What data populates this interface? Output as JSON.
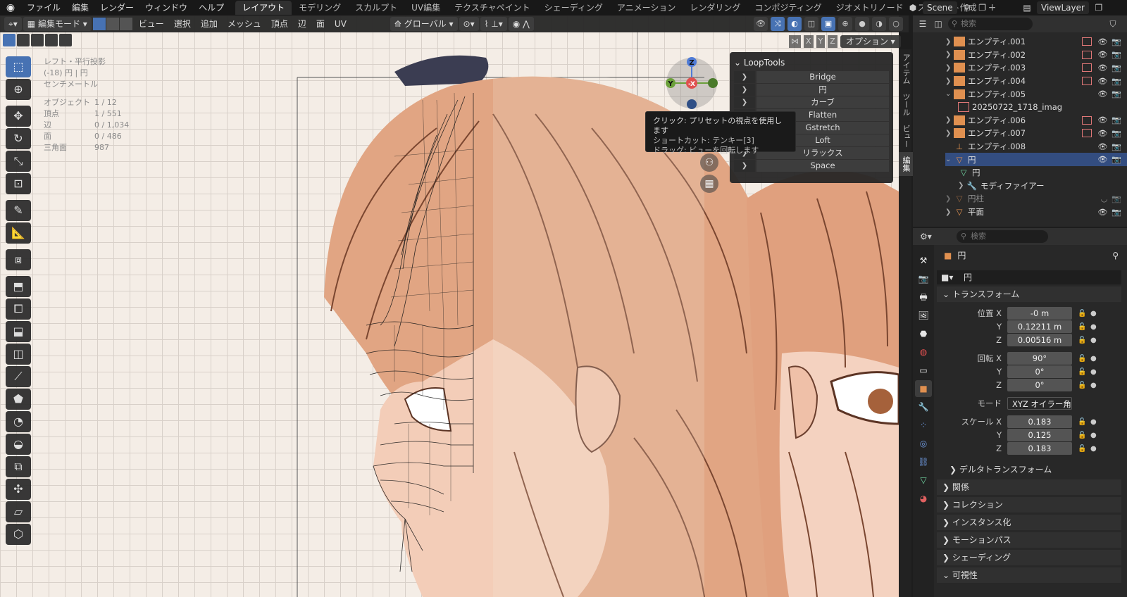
{
  "menubar": {
    "menus": [
      "ファイル",
      "編集",
      "レンダー",
      "ウィンドウ",
      "ヘルプ"
    ],
    "workspaces": [
      "レイアウト",
      "モデリング",
      "スカルプト",
      "UV編集",
      "テクスチャペイント",
      "シェーディング",
      "アニメーション",
      "レンダリング",
      "コンポジティング",
      "ジオメトリノード",
      "スクリプト作成"
    ],
    "active_workspace": "レイアウト",
    "scene": "Scene",
    "view_layer": "ViewLayer"
  },
  "viewport_header": {
    "mode": "編集モード",
    "menus": [
      "ビュー",
      "選択",
      "追加",
      "メッシュ",
      "頂点",
      "辺",
      "面",
      "UV"
    ],
    "transform_orientation": "グローバル",
    "options_label": "オプション",
    "axes": [
      "X",
      "Y",
      "Z"
    ]
  },
  "stats": {
    "view_name": "レフト・平行投影",
    "object_name": "(-18) 円 | 円",
    "units": "センチメートル",
    "rows": [
      {
        "label": "オブジェクト",
        "value": "1 / 12"
      },
      {
        "label": "頂点",
        "value": "1 / 551"
      },
      {
        "label": "辺",
        "value": "0 / 1,034"
      },
      {
        "label": "面",
        "value": "0 / 486"
      },
      {
        "label": "三角面",
        "value": "987"
      }
    ]
  },
  "looptools": {
    "title": "LoopTools",
    "items": [
      "Bridge",
      "円",
      "カーブ",
      "Flatten",
      "Gstretch",
      "Loft",
      "リラックス",
      "Space"
    ]
  },
  "tooltip": {
    "line1": "クリック: プリセットの視点を使用します",
    "line2": "ショートカット: テンキー[3]",
    "line3": "ドラッグ: ビューを回転します"
  },
  "gizmo": {
    "z": "Z",
    "y": "Y",
    "x": "-X"
  },
  "npanel_tabs": [
    "アイテム",
    "ツール",
    "ビュー",
    "編集"
  ],
  "outliner": {
    "search_placeholder": "検索",
    "rows": [
      {
        "name": "エンプティ.001",
        "type": "empty",
        "extra": true
      },
      {
        "name": "エンプティ.002",
        "type": "empty",
        "extra": true
      },
      {
        "name": "エンプティ.003",
        "type": "empty",
        "extra": true
      },
      {
        "name": "エンプティ.004",
        "type": "empty",
        "extra": true
      },
      {
        "name": "エンプティ.005",
        "type": "empty",
        "expanded": true
      },
      {
        "name": "20250722_1718_imag",
        "type": "image",
        "indent": 1
      },
      {
        "name": "エンプティ.006",
        "type": "empty",
        "extra": true
      },
      {
        "name": "エンプティ.007",
        "type": "empty",
        "extra": true
      },
      {
        "name": "エンプティ.008",
        "type": "empty-axes"
      },
      {
        "name": "円",
        "type": "mesh",
        "expanded": true
      },
      {
        "name": "円",
        "type": "meshdata",
        "indent": 1
      },
      {
        "name": "モディファイアー",
        "type": "modifier",
        "indent": 1
      },
      {
        "name": "円柱",
        "type": "mesh",
        "dim": true
      },
      {
        "name": "平面",
        "type": "mesh"
      }
    ]
  },
  "properties": {
    "search_placeholder": "検索",
    "object_title": "円",
    "object_field": "円",
    "transform_label": "トランスフォーム",
    "location": {
      "label": "位置 X",
      "x": "-0 m",
      "y": "0.12211 m",
      "z": "0.00516 m"
    },
    "rotation": {
      "label": "回転 X",
      "x": "90°",
      "y": "0°",
      "z": "0°"
    },
    "mode": {
      "label": "モード",
      "value": "XYZ オイラー角"
    },
    "scale": {
      "label": "スケール X",
      "x": "0.183",
      "y": "0.125",
      "z": "0.183"
    },
    "axis_y": "Y",
    "axis_z": "Z",
    "delta_transform": "デルタトランスフォーム",
    "sections": [
      "関係",
      "コレクション",
      "インスタンス化",
      "モーションパス",
      "シェーディング",
      "可視性"
    ]
  }
}
